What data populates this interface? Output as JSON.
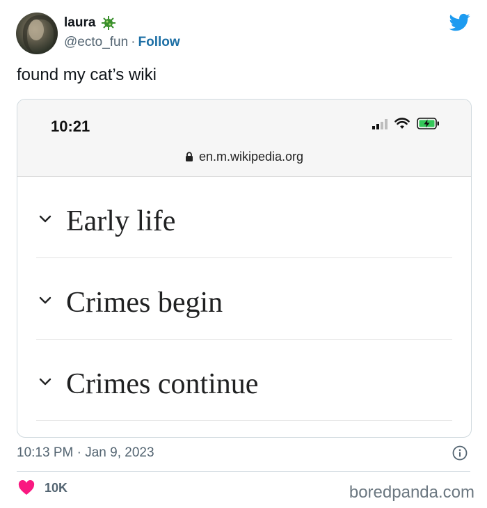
{
  "author": {
    "name": "laura",
    "handle": "@ecto_fun",
    "separator": "·",
    "follow_label": "Follow",
    "badge_icon": "green-virus-emoji"
  },
  "tweet": {
    "text": "found my cat’s wiki",
    "timestamp": "10:13 PM · Jan 9, 2023",
    "like_count": "10K"
  },
  "screenshot": {
    "time": "10:21",
    "url": "en.m.wikipedia.org",
    "sections": [
      {
        "label": "Early life"
      },
      {
        "label": "Crimes begin"
      },
      {
        "label": "Crimes continue"
      }
    ]
  },
  "watermark": "boredpanda.com",
  "colors": {
    "twitter_blue": "#1d9bf0",
    "follow_link": "#1d6fa5",
    "heart": "#f91880",
    "muted_text": "#536471",
    "battery_green": "#34c759"
  }
}
